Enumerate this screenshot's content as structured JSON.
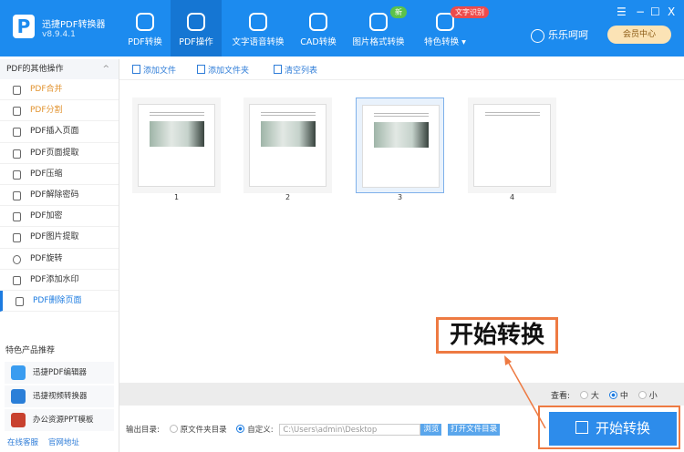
{
  "app": {
    "name": "迅捷PDF转换器",
    "version": "v8.9.4.1",
    "user": "乐乐呵呵",
    "vip": "会员中心"
  },
  "nav": [
    {
      "label": "PDF转换"
    },
    {
      "label": "PDF操作"
    },
    {
      "label": "文字语音转换"
    },
    {
      "label": "CAD转换"
    },
    {
      "label": "图片格式转换",
      "badge": "新"
    },
    {
      "label": "特色转换 ▾",
      "badge": "文字识别"
    }
  ],
  "window": {
    "menu": "☰",
    "min": "−",
    "max": "☐",
    "close": "X"
  },
  "sidebar": {
    "title": "PDF的其他操作",
    "items": [
      "PDF合并",
      "PDF分割",
      "PDF插入页面",
      "PDF页面提取",
      "PDF压缩",
      "PDF解除密码",
      "PDF加密",
      "PDF图片提取",
      "PDF旋转",
      "PDF添加水印",
      "PDF删除页面"
    ],
    "rec_title": "特色产品推荐",
    "recs": [
      "迅捷PDF编辑器",
      "迅捷视频转换器",
      "办公资源PPT模板"
    ],
    "online": "在线客服",
    "website": "官网地址"
  },
  "toolbar": {
    "add_file": "添加文件",
    "add_folder": "添加文件夹",
    "clear": "清空列表"
  },
  "pages": [
    "1",
    "2",
    "3",
    "4"
  ],
  "view": {
    "label": "查看:",
    "options": [
      "大",
      "中",
      "小"
    ],
    "selected": "中"
  },
  "output": {
    "label": "输出目录:",
    "opt1": "原文件夹目录",
    "opt2": "自定义:",
    "path": "C:\\Users\\admin\\Desktop",
    "browse": "浏览",
    "open": "打开文件目录"
  },
  "start": "开始转换",
  "callout": "开始转换"
}
